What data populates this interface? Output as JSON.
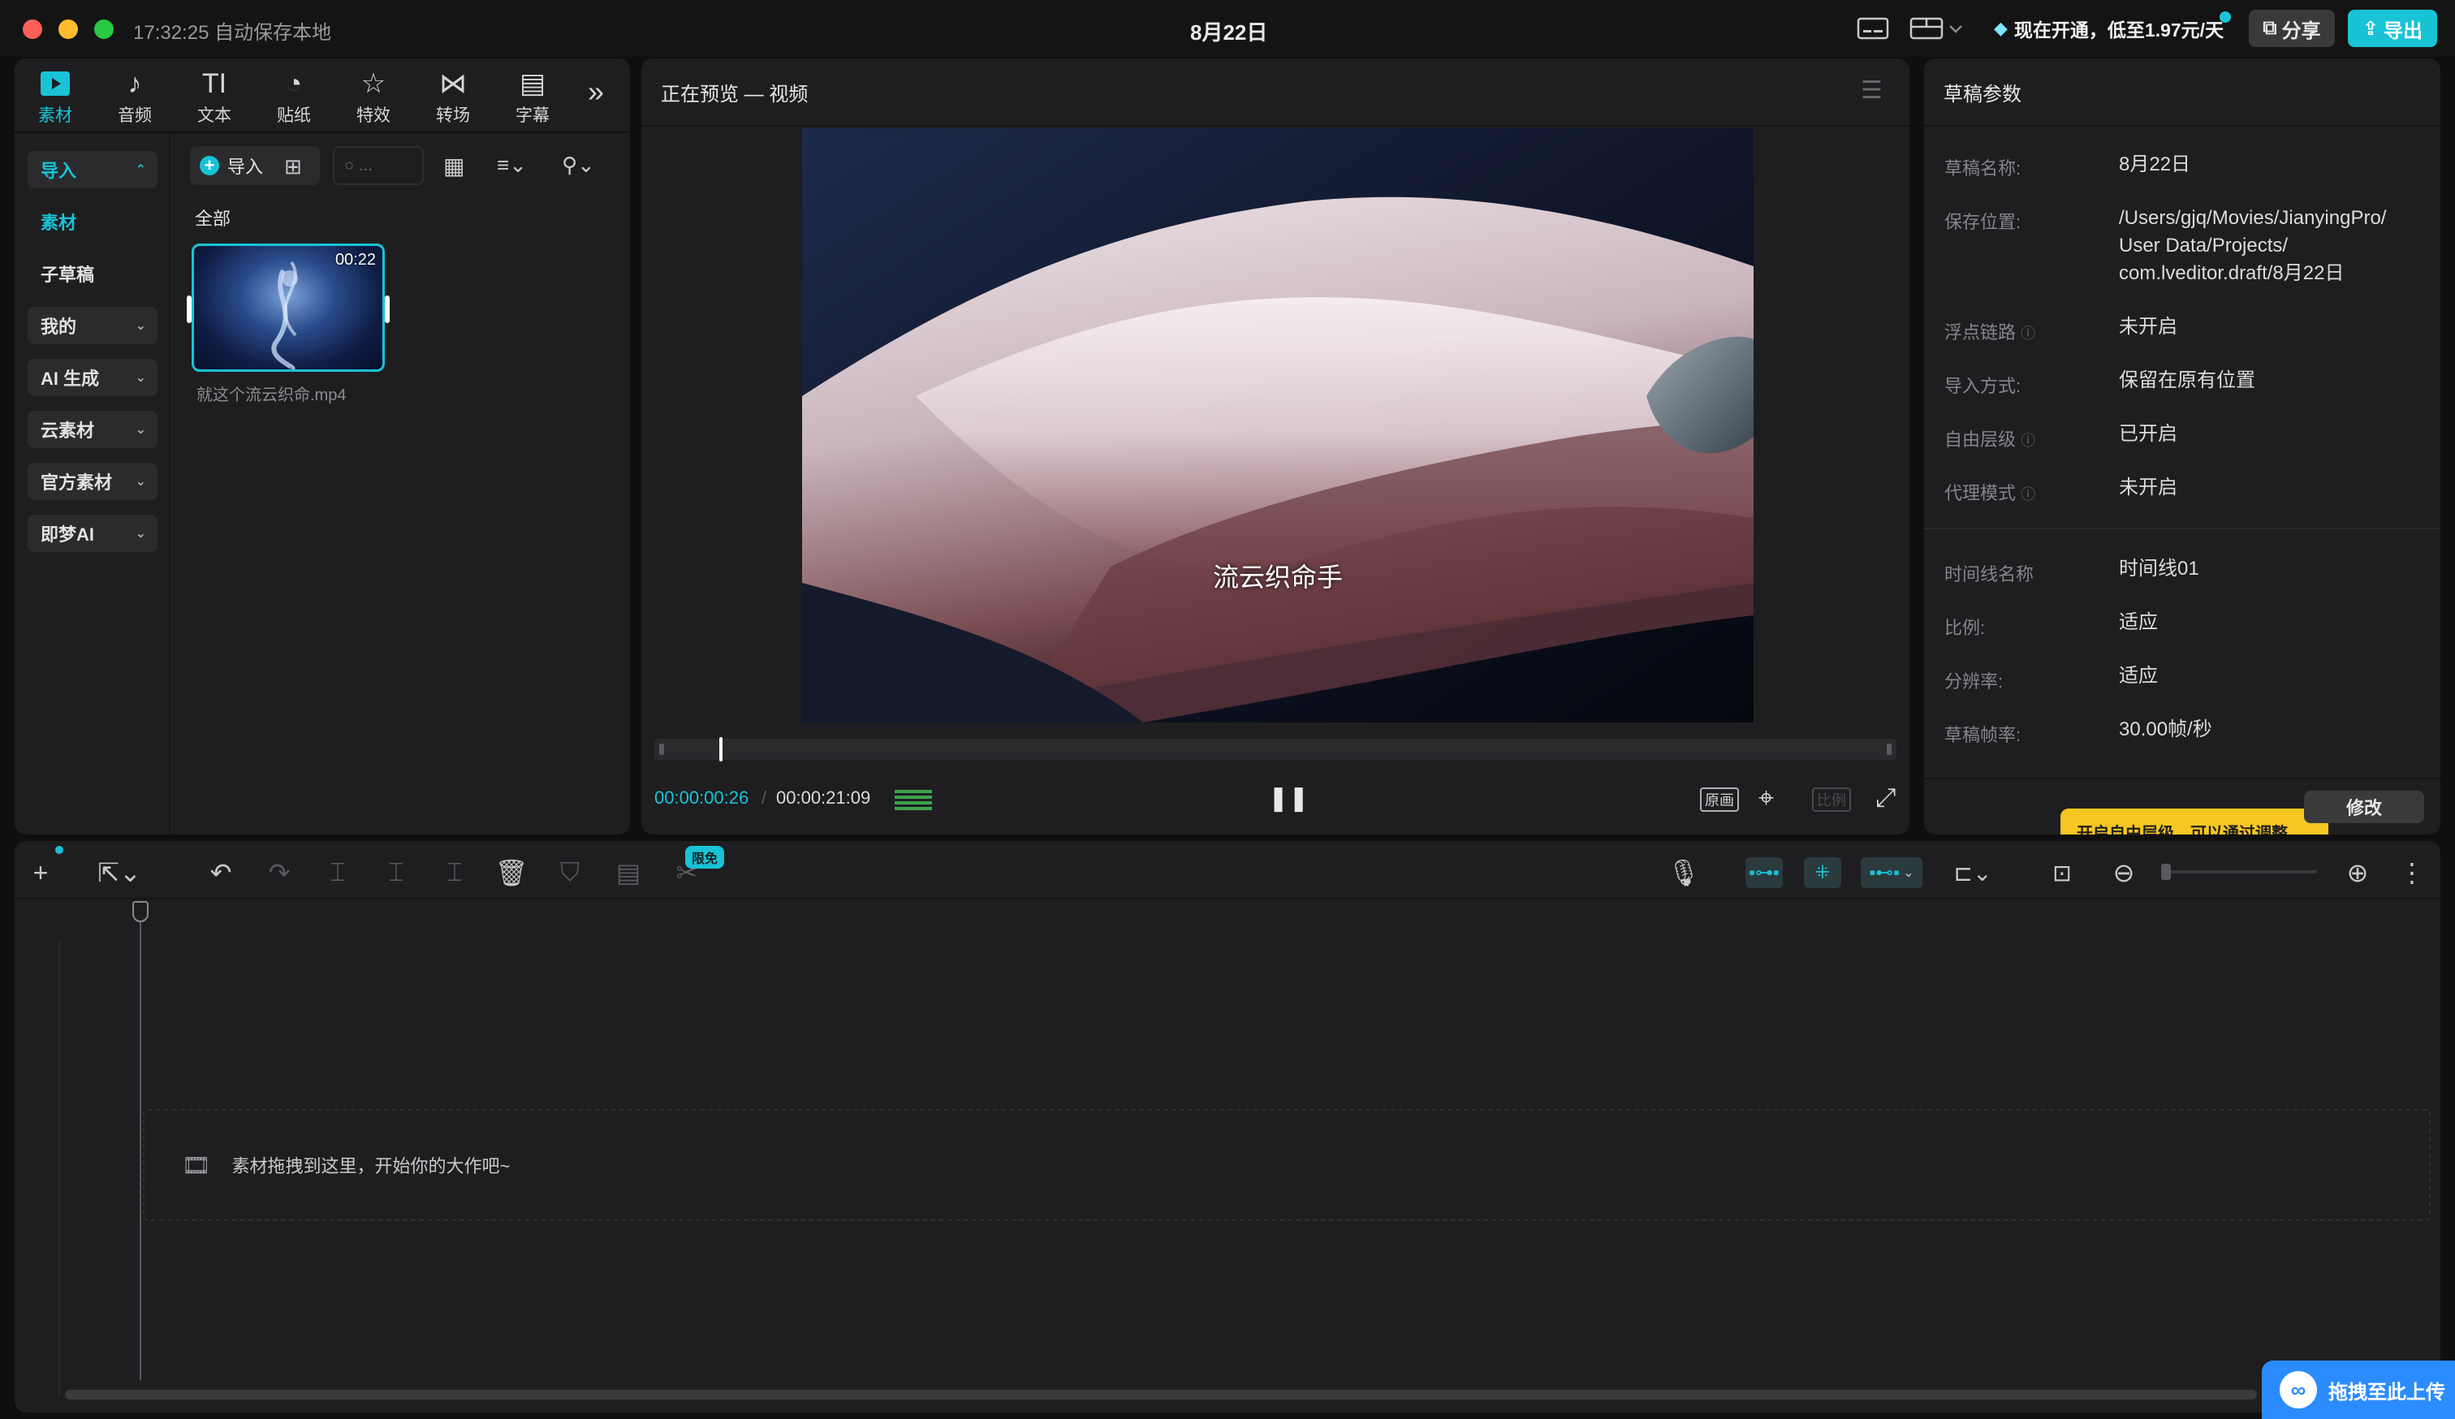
{
  "titlebar": {
    "autosave": "17:32:25 自动保存本地",
    "title": "8月22日",
    "promo": "现在开通，低至1.97元/天",
    "share": "分享",
    "export": "导出"
  },
  "toolbar": {
    "tools": [
      {
        "label": "素材",
        "icon": "media-icon"
      },
      {
        "label": "音频",
        "icon": "audio-icon"
      },
      {
        "label": "文本",
        "icon": "text-icon"
      },
      {
        "label": "贴纸",
        "icon": "sticker-icon"
      },
      {
        "label": "特效",
        "icon": "effects-icon"
      },
      {
        "label": "转场",
        "icon": "transition-icon"
      },
      {
        "label": "字幕",
        "icon": "subtitle-icon"
      }
    ],
    "tool_glyphs": [
      "▶",
      "♪",
      "TI",
      "◔",
      "☆",
      "⋈",
      "▤"
    ],
    "more": "»"
  },
  "sidebar": {
    "items": [
      {
        "label": "导入",
        "chevron": "⌃"
      },
      {
        "label": "素材",
        "chevron": ""
      },
      {
        "label": "子草稿",
        "chevron": ""
      },
      {
        "label": "我的",
        "chevron": "⌄"
      },
      {
        "label": "AI 生成",
        "chevron": "⌄"
      },
      {
        "label": "云素材",
        "chevron": "⌄"
      },
      {
        "label": "官方素材",
        "chevron": "⌄"
      },
      {
        "label": "即梦AI",
        "chevron": "⌄"
      }
    ]
  },
  "media": {
    "import_label": "导入",
    "search_placeholder": "...",
    "filter_all": "全部",
    "clip": {
      "duration": "00:22",
      "filename": "就这个流云织命.mp4"
    }
  },
  "preview": {
    "title": "正在预览 — 视频",
    "subtitle": "流云织命手",
    "current_time": "00:00:00:26",
    "total_time": "00:00:21:09",
    "original_btn": "原画",
    "ratio_btn": "比例",
    "progress": 0.04
  },
  "params": {
    "title": "草稿参数",
    "rows": [
      {
        "label": "草稿名称:",
        "value": "8月22日"
      },
      {
        "label": "保存位置:",
        "value": "/Users/gjq/Movies/JianyingPro/\nUser Data/Projects/\ncom.lveditor.draft/8月22日"
      },
      {
        "label": "浮点链路",
        "value": "未开启"
      },
      {
        "label": "导入方式:",
        "value": "保留在原有位置"
      },
      {
        "label": "自由层级",
        "value": "已开启"
      },
      {
        "label": "代理模式",
        "value": "未开启"
      },
      {
        "label": "时间线名称",
        "value": "时间线01"
      },
      {
        "label": "比例:",
        "value": "适应"
      },
      {
        "label": "分辨率:",
        "value": "适应"
      },
      {
        "label": "草稿帧率:",
        "value": "30.00帧/秒"
      }
    ],
    "modify_btn": "修改",
    "tooltip": "开启自由层级，可以通过调整"
  },
  "timeline": {
    "badge": "限免",
    "drop_hint": "素材拖拽到这里，开始你的大作吧~"
  },
  "upload": {
    "label": "拖拽至此上传"
  },
  "colors": {
    "accent": "#19c3d6",
    "promo_yellow": "#f6c623",
    "upload_blue": "#2b8cff"
  }
}
